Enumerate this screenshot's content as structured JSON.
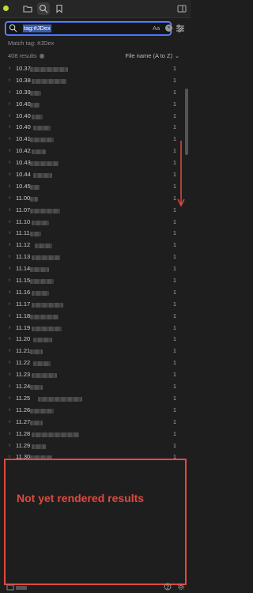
{
  "colors": {
    "accent": "#7aa6ff",
    "highlight": "#3d5da8",
    "annotation": "#e04a3f",
    "bg": "#1e1e1e"
  },
  "titlebar": {
    "icons": [
      "folder-icon",
      "search-icon",
      "bookmark-icon"
    ],
    "active_tab": "search-icon",
    "right_icon": "sidebar-toggle-icon"
  },
  "search": {
    "query": "tag:#JDex",
    "match_case_label": "Aa",
    "clear_icon": "close-icon",
    "settings_icon": "settings-sliders-icon"
  },
  "match_label": "Match tag: #JDex",
  "results": {
    "count_text": "408 results",
    "sort_label": "File name (A to Z)",
    "rows": [
      {
        "name": "10.37",
        "count": "1"
      },
      {
        "name": "10.38",
        "count": "1"
      },
      {
        "name": "10.39",
        "count": "1"
      },
      {
        "name": "10.40",
        "count": "1"
      },
      {
        "name": "10.40",
        "count": "1"
      },
      {
        "name": "10.40",
        "count": "1"
      },
      {
        "name": "10.41",
        "count": "1"
      },
      {
        "name": "10.42",
        "count": "1"
      },
      {
        "name": "10.43",
        "count": "1"
      },
      {
        "name": "10.44",
        "count": "1"
      },
      {
        "name": "10.45",
        "count": "1"
      },
      {
        "name": "11.00",
        "count": "1"
      },
      {
        "name": "11.07",
        "count": "1"
      },
      {
        "name": "11.10",
        "count": "1"
      },
      {
        "name": "11.11",
        "count": "1"
      },
      {
        "name": "11.12",
        "count": "1"
      },
      {
        "name": "11.13",
        "count": "1"
      },
      {
        "name": "11.14",
        "count": "1"
      },
      {
        "name": "11.15",
        "count": "1"
      },
      {
        "name": "11.16",
        "count": "1"
      },
      {
        "name": "11.17",
        "count": "1"
      },
      {
        "name": "11.18",
        "count": "1"
      },
      {
        "name": "11.19",
        "count": "1"
      },
      {
        "name": "11.20",
        "count": "1"
      },
      {
        "name": "11.21",
        "count": "1"
      },
      {
        "name": "11.22",
        "count": "1"
      },
      {
        "name": "11.23",
        "count": "1"
      },
      {
        "name": "11.24",
        "count": "1"
      },
      {
        "name": "11.25",
        "count": "1"
      },
      {
        "name": "11.26",
        "count": "1"
      },
      {
        "name": "11.27",
        "count": "1"
      },
      {
        "name": "11.28",
        "count": "1"
      },
      {
        "name": "11.29",
        "count": "1"
      },
      {
        "name": "11.30",
        "count": "1"
      }
    ]
  },
  "annotation": {
    "label": "Not yet rendered results"
  }
}
